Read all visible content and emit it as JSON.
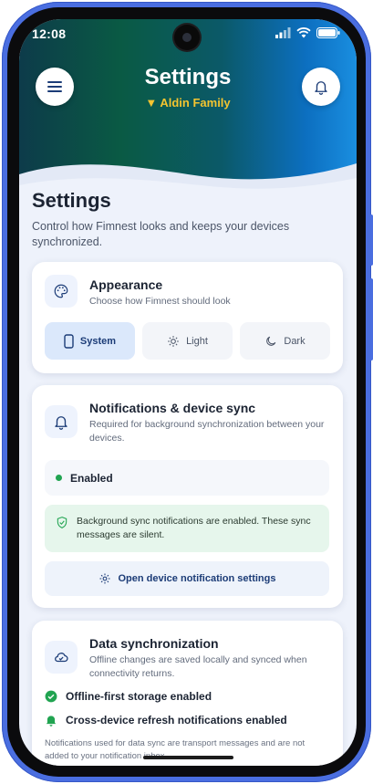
{
  "status_bar": {
    "time": "12:08"
  },
  "header": {
    "title": "Settings",
    "household": "Aldin Family",
    "household_caret": "▼"
  },
  "page": {
    "title": "Settings",
    "description": "Control how Fimnest looks and keeps your devices synchronized."
  },
  "appearance": {
    "title": "Appearance",
    "description": "Choose how Fimnest should look",
    "options": [
      {
        "label": "System",
        "icon": "phone-icon",
        "selected": true
      },
      {
        "label": "Light",
        "icon": "sun-icon",
        "selected": false
      },
      {
        "label": "Dark",
        "icon": "moon-icon",
        "selected": false
      }
    ]
  },
  "notifications": {
    "title": "Notifications & device sync",
    "description": "Required for background synchronization between your devices.",
    "status": "Enabled",
    "info": "Background sync notifications are enabled. These sync messages are silent.",
    "action": "Open device notification settings"
  },
  "data_sync": {
    "title": "Data synchronization",
    "description": "Offline changes are saved locally and synced when connectivity returns.",
    "features": [
      {
        "label": "Offline-first storage enabled",
        "icon": "check-circle-icon"
      },
      {
        "label": "Cross-device refresh notifications enabled",
        "icon": "bell-icon"
      }
    ],
    "footnote": "Notifications used for data sync are transport messages and are not added to your notification inbox."
  },
  "colors": {
    "accent": "#1c3c77",
    "success": "#21a451",
    "household_gold": "#f4c430",
    "device_frame": "#4a6ee0"
  }
}
